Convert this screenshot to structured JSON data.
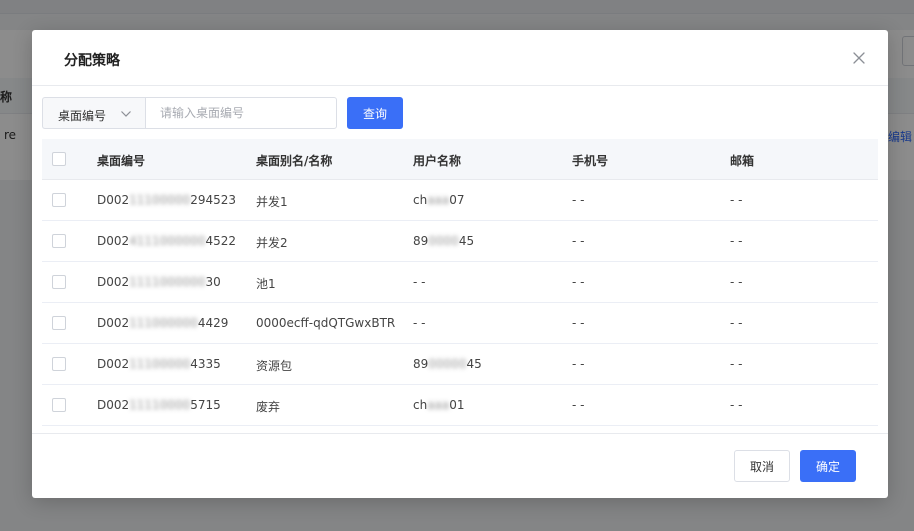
{
  "background": {
    "header_label": "称",
    "row_label": "re",
    "edit_link": "编辑"
  },
  "modal": {
    "title": "分配策略",
    "search": {
      "field_selected": "桌面编号",
      "placeholder": "请输入桌面编号",
      "value": "",
      "button": "查询"
    },
    "table": {
      "columns": [
        "桌面编号",
        "桌面别名/名称",
        "用户名称",
        "手机号",
        "邮箱"
      ],
      "rows": [
        {
          "id_prefix": "D002",
          "id_masked": "11100000",
          "id_suffix": "294523",
          "alias": "并发1",
          "user_prefix": "ch",
          "user_masked": "aaa",
          "user_suffix": "07",
          "phone": "- -",
          "email": "- -"
        },
        {
          "id_prefix": "D002",
          "id_masked": "4111000000",
          "id_suffix": "4522",
          "alias": "并发2",
          "user_prefix": "89",
          "user_masked": "0000",
          "user_suffix": "45",
          "phone": "- -",
          "email": "- -"
        },
        {
          "id_prefix": "D002",
          "id_masked": "1111000000",
          "id_suffix": "30",
          "alias": "池1",
          "user_prefix": "- -",
          "user_masked": "",
          "user_suffix": "",
          "phone": "- -",
          "email": "- -"
        },
        {
          "id_prefix": "D002",
          "id_masked": "111000000",
          "id_suffix": "4429",
          "alias": "0000ecff-qdQTGwxBTR",
          "user_prefix": "- -",
          "user_masked": "",
          "user_suffix": "",
          "phone": "- -",
          "email": "- -"
        },
        {
          "id_prefix": "D002",
          "id_masked": "11100000",
          "id_suffix": "4335",
          "alias": "资源包",
          "user_prefix": "89",
          "user_masked": "00000",
          "user_suffix": "45",
          "phone": "- -",
          "email": "- -"
        },
        {
          "id_prefix": "D002",
          "id_masked": "11110000",
          "id_suffix": "5715",
          "alias": "废弃",
          "user_prefix": "ch",
          "user_masked": "aaa",
          "user_suffix": "01",
          "phone": "- -",
          "email": "- -"
        }
      ]
    },
    "footer": {
      "cancel": "取消",
      "confirm": "确定"
    }
  },
  "colors": {
    "primary": "#3a6ff7",
    "header_bg": "#f5f7fa",
    "border": "#e8eaee"
  }
}
